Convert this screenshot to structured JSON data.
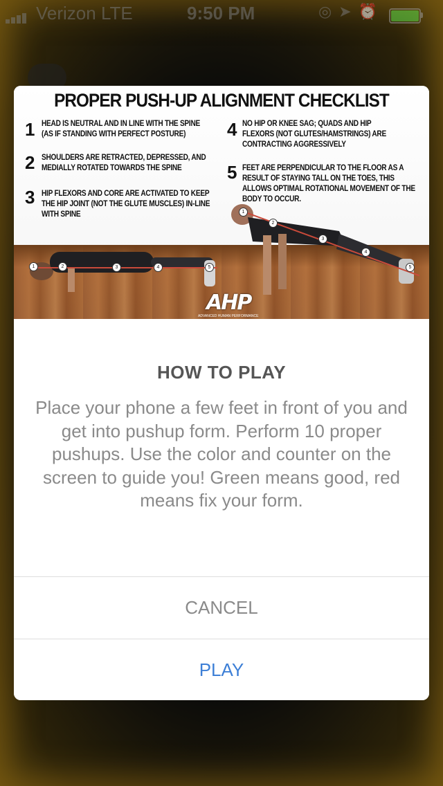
{
  "status_bar": {
    "carrier": "Verizon  LTE",
    "time": "9:50 PM",
    "battery_color": "#5ee04a"
  },
  "dialog": {
    "image": {
      "title": "PROPER PUSH-UP ALIGNMENT CHECKLIST",
      "tips": [
        {
          "num": "1",
          "text": "HEAD IS NEUTRAL AND IN LINE WITH THE SPINE (AS IF STANDING WITH PERFECT POSTURE)"
        },
        {
          "num": "2",
          "text": "SHOULDERS ARE RETRACTED, DEPRESSED, AND MEDIALLY ROTATED TOWARDS THE SPINE"
        },
        {
          "num": "3",
          "text": "HIP FLEXORS AND CORE ARE ACTIVATED TO KEEP THE HIP JOINT (NOT THE GLUTE MUSCLES) IN-LINE WITH SPINE"
        },
        {
          "num": "4",
          "text": "NO HIP OR KNEE SAG; QUADS AND HIP FLEXORS (NOT GLUTES/HAMSTRINGS) ARE CONTRACTING AGGRESSIVELY"
        },
        {
          "num": "5",
          "text": "FEET ARE PERPENDICULAR TO THE FLOOR AS A RESULT OF STAYING TALL ON THE TOES, THIS ALLOWS OPTIMAL ROTATIONAL MOVEMENT OF THE BODY TO OCCUR."
        }
      ],
      "logo": "AHP",
      "logo_sub": "ADVANCED HUMAN PERFORMANCE",
      "markers": [
        "1",
        "2",
        "3",
        "4",
        "5"
      ]
    },
    "title": "HOW TO PLAY",
    "body": "Place your phone a few feet in front of you and get into pushup form. Perform 10 proper pushups. Use the color and counter on the screen to guide you! Green means good, red means fix your form.",
    "buttons": {
      "cancel": "CANCEL",
      "play": "PLAY"
    }
  },
  "colors": {
    "accent": "#3d7fd6",
    "muted_text": "#8a8a8a",
    "title_text": "#555555",
    "alignment_line": "#c94a3a"
  }
}
